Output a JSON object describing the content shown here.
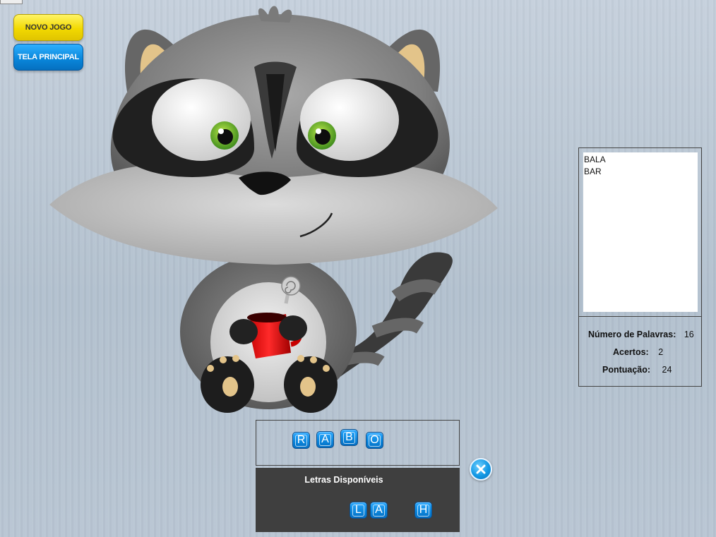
{
  "toolbar": {
    "new_game_label": "NOVO JOGO",
    "main_screen_label": "TELA PRINCIPAL"
  },
  "found_words": [
    "BALA",
    "BAR"
  ],
  "stats": {
    "word_count_label": "Número de Palavras:",
    "word_count_value": "16",
    "hits_label": "Acertos:",
    "hits_value": "2",
    "score_label": "Pontuação:",
    "score_value": "24"
  },
  "current_word": {
    "letters": [
      "R",
      "A",
      "B",
      "O"
    ]
  },
  "available_letters": {
    "title": "Letras Disponíveis",
    "letters": [
      "L",
      "A",
      "H"
    ]
  },
  "colors": {
    "accent_blue": "#0b85db",
    "accent_yellow": "#f2d900",
    "panel_dark": "#3f3f3f"
  },
  "icons": {
    "close": "close-icon",
    "mascot": "raccoon-mascot"
  }
}
